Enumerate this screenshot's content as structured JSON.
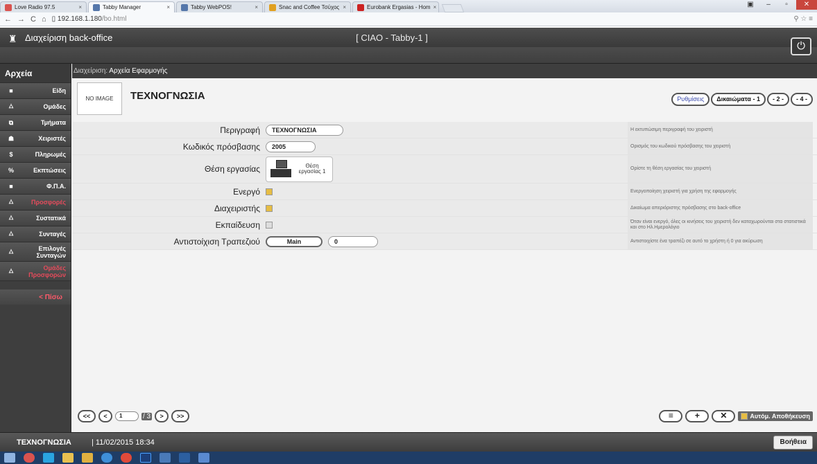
{
  "browser": {
    "tabs": [
      {
        "label": "Love Radio 97.5",
        "favcolor": "#d9534f",
        "active": false
      },
      {
        "label": "Tabby Manager",
        "favcolor": "#5577aa",
        "active": true
      },
      {
        "label": "Tabby WebPOS!",
        "favcolor": "#5577aa",
        "active": false
      },
      {
        "label": "Snac and Coffee Τσύχος",
        "favcolor": "#e0a020",
        "active": false
      },
      {
        "label": "Eurobank Ergasias - Hom",
        "favcolor": "#cc2222",
        "active": false
      }
    ],
    "url_host": "192.168.1.180",
    "url_path": "/bo.html"
  },
  "app": {
    "title": "Διαχείριση back-office",
    "center_title": "[ CIAO - Tabby-1 ]"
  },
  "sidebar": {
    "heading": "Αρχεία",
    "items": [
      {
        "label": "Είδη",
        "icon": "square-icon",
        "red": false
      },
      {
        "label": "Ομάδες",
        "icon": "hierarchy-icon",
        "red": false
      },
      {
        "label": "Τμήματα",
        "icon": "departments-icon",
        "red": false
      },
      {
        "label": "Χειριστές",
        "icon": "person-icon",
        "red": false
      },
      {
        "label": "Πληρωμές",
        "icon": "dollar-icon",
        "red": false
      },
      {
        "label": "Εκπτώσεις",
        "icon": "percent-icon",
        "red": false
      },
      {
        "label": "Φ.Π.Α.",
        "icon": "square-icon",
        "red": false
      },
      {
        "label": "Προσφορές",
        "icon": "hierarchy-icon",
        "red": true
      },
      {
        "label": "Συστατικά",
        "icon": "hierarchy-icon",
        "red": false
      },
      {
        "label": "Συνταγές",
        "icon": "hierarchy-icon",
        "red": false
      },
      {
        "label": "Επιλογές Συνταγών",
        "icon": "hierarchy-icon",
        "red": false
      },
      {
        "label": "Ομάδες Προσφορών",
        "icon": "hierarchy-icon",
        "red": true
      }
    ],
    "back": "< Πίσω"
  },
  "breadcrumb": {
    "prefix": "Διαχείριση",
    "current": "Αρχεία Εφαρμογής"
  },
  "record": {
    "image_text": "NO IMAGE",
    "title": "ΤΕΧΝΟΓΝΩΣΙΑ"
  },
  "tabs_right": [
    {
      "label": "Ρυθμίσεις",
      "active": true
    },
    {
      "label": "Δικαιώματα - 1",
      "active": false
    },
    {
      "label": "- 2 -",
      "active": false
    },
    {
      "label": "- 4 -",
      "active": false
    }
  ],
  "form": {
    "description": {
      "label": "Περιγραφή",
      "value": "ΤΕΧΝΟΓΝΩΣΙΑ",
      "help": "Η εκτυπώσιμη περιγραφή του χειριστή"
    },
    "password": {
      "label": "Κωδικός πρόσβασης",
      "value": "2005",
      "help": "Ορισμός του κωδικού πρόσβασης του χειριστή"
    },
    "workstation": {
      "label": "Θέση εργασίας",
      "card_text": "Θέση εργασίας 1",
      "help": "Ορίστε τη θέση εργασίας του χειριστή"
    },
    "active": {
      "label": "Ενεργό",
      "checked": true,
      "help": "Ενεργοποίηση χειριστή για χρήση της εφαρμογής"
    },
    "admin": {
      "label": "Διαχειριστής",
      "checked": true,
      "help": "Δικαίωμα απεριόριστης πρόσβασης στο back-office"
    },
    "training": {
      "label": "Εκπαίδευση",
      "checked": false,
      "help": "Όταν είναι ενεργό, όλες οι κινήσεις του χειριστή δεν καταχωρούνται στα στατιστικά και στο Ηλ.Ημερολόγιο"
    },
    "table": {
      "label": "Αντιστοίχιση Τραπεζιού",
      "button": "Main",
      "value": "0",
      "help": "Αντιστοιχίστε ένα τραπέζι σε αυτό το χρήστη ή 0 για ακύρωση"
    }
  },
  "pager": {
    "first": "<<",
    "prev": "<",
    "current": "1",
    "total": "/ 3",
    "next": ">",
    "last": ">>"
  },
  "actions": {
    "list": "≡",
    "add": "+",
    "delete": "✕",
    "autosave": "Αυτόμ. Αποθήκευση"
  },
  "status": {
    "user": "ΤΕΧΝΟΓΝΩΣΙΑ",
    "datetime": "| 11/02/2015 18:34",
    "help": "Βοήθεια"
  }
}
